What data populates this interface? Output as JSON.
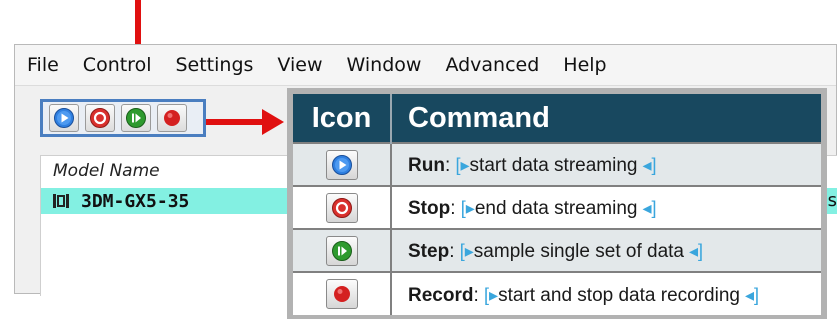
{
  "menubar": {
    "items": [
      "File",
      "Control",
      "Settings",
      "View",
      "Window",
      "Advanced",
      "Help"
    ]
  },
  "toolbar": {
    "buttons": [
      {
        "icon": "run-icon",
        "color": "#2f7fe0"
      },
      {
        "icon": "stop-icon",
        "color": "#d9302c"
      },
      {
        "icon": "step-icon",
        "color": "#2e9a2e"
      },
      {
        "icon": "record-icon",
        "color": "#d42020"
      }
    ]
  },
  "device_list": {
    "column_header": "Model Name",
    "rows": [
      {
        "name": "3DM-GX5-35",
        "trailing": "s"
      }
    ]
  },
  "command_table": {
    "headers": {
      "icon": "Icon",
      "command": "Command"
    },
    "header_color": "#18485f",
    "rows": [
      {
        "icon": "run-icon",
        "name": "Run",
        "separator": ":",
        "description": "start data streaming"
      },
      {
        "icon": "stop-icon",
        "name": "Stop",
        "separator": ":",
        "description": "end data streaming"
      },
      {
        "icon": "step-icon",
        "name": "Step",
        "separator": ":",
        "description": "sample single set of data"
      },
      {
        "icon": "record-icon",
        "name": "Record",
        "separator": ":",
        "description": "start and stop data recording"
      }
    ]
  },
  "annotation_color": "#e01010"
}
